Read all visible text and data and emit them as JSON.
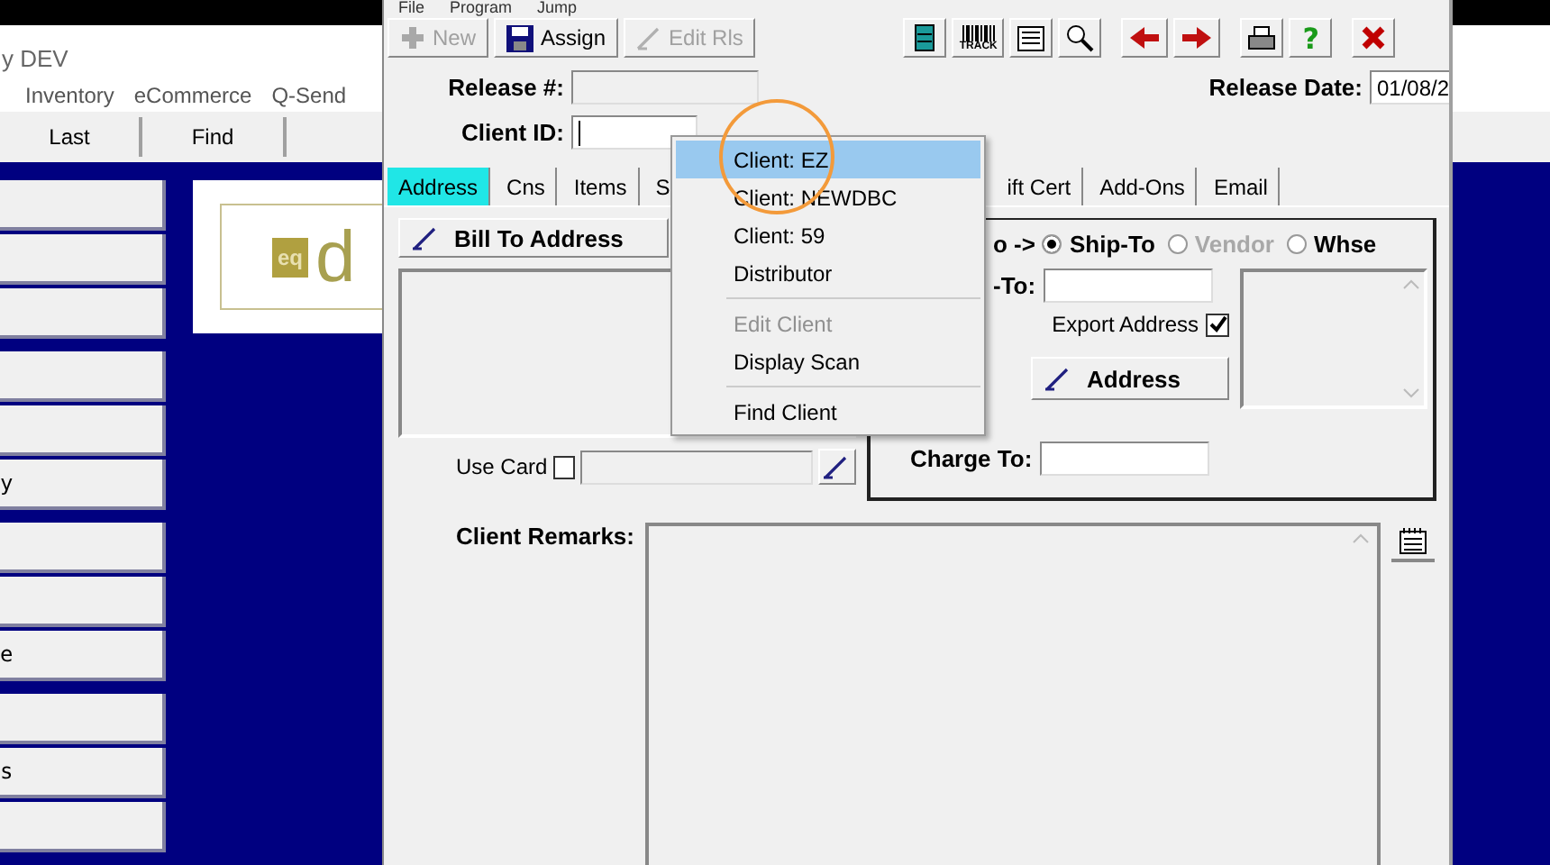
{
  "background_app": {
    "title": "y DEV",
    "menu": [
      "Inventory",
      "eCommerce",
      "Q-Send"
    ],
    "toolbar": [
      {
        "label": "Last"
      },
      {
        "label": "Find"
      }
    ],
    "side_groups": [
      [
        {
          "kind": "blank"
        },
        {
          "kind": "blank"
        },
        {
          "kind": "blank"
        }
      ],
      [
        {
          "kind": "blank"
        },
        {
          "kind": "blank"
        },
        {
          "kind": "labeled",
          "label": "y"
        }
      ],
      [
        {
          "kind": "blank"
        },
        {
          "kind": "blank"
        },
        {
          "kind": "labeled",
          "label": "e"
        }
      ],
      [
        {
          "kind": "blank"
        },
        {
          "kind": "labeled",
          "label": "s"
        },
        {
          "kind": "blank"
        }
      ]
    ],
    "logo": {
      "badge": "eq",
      "text": "d"
    }
  },
  "dialog": {
    "menu": [
      "File",
      "Program",
      "Jump"
    ],
    "toolbar": [
      {
        "label": "New",
        "disabled": true,
        "kind": "plus"
      },
      {
        "label": "Assign",
        "disabled": false,
        "kind": "floppy"
      },
      {
        "label": "Edit Rls",
        "disabled": true,
        "kind": "pen"
      }
    ],
    "tools": [
      {
        "kind": "cabinet"
      },
      {
        "kind": "barcode",
        "label": "TRACK"
      },
      {
        "kind": "document"
      },
      {
        "kind": "magnifier"
      },
      {
        "kind": "left"
      },
      {
        "kind": "right"
      },
      {
        "kind": "printer"
      },
      {
        "kind": "help",
        "label": "?"
      },
      {
        "kind": "close"
      }
    ],
    "release_label": "Release #:",
    "release_date_label": "Release Date:",
    "release_date": "01/08/2",
    "client_id_label": "Client ID:",
    "tabs": [
      {
        "label": "Address",
        "selected": true
      },
      {
        "label": "Cns",
        "selected": false
      },
      {
        "label": "Items",
        "selected": false
      },
      {
        "label": "S",
        "selected": false
      },
      {
        "label": "ift Cert",
        "selected": false
      },
      {
        "label": "Add-Ons",
        "selected": false
      },
      {
        "label": "Email",
        "selected": false
      }
    ],
    "bill_to_button": "Bill To Address",
    "use_card": {
      "label": "Use Card",
      "checked": false
    },
    "address_target_label": "o ->",
    "radios": [
      {
        "label": "Ship-To",
        "selected": true,
        "disabled": false
      },
      {
        "label": "Vendor",
        "selected": false,
        "disabled": true
      },
      {
        "label": "Whse",
        "selected": false,
        "disabled": false
      }
    ],
    "ship_to_label": "-To:",
    "export_address": {
      "label": "Export Address",
      "checked": true
    },
    "address_button": "Address",
    "charge_to_label": "Charge To:",
    "remarks_label": "Client Remarks:",
    "popup_menu": [
      {
        "kind": "item",
        "label": "Client: EZ",
        "selected": true,
        "disabled": false
      },
      {
        "kind": "item",
        "label": "Client: NEWDBC",
        "selected": false,
        "disabled": false
      },
      {
        "kind": "item",
        "label": "Client: 59",
        "selected": false,
        "disabled": false
      },
      {
        "kind": "item",
        "label": "Distributor",
        "selected": false,
        "disabled": false
      },
      {
        "kind": "separator"
      },
      {
        "kind": "item",
        "label": "Edit Client",
        "selected": false,
        "disabled": true
      },
      {
        "kind": "item",
        "label": "Display Scan",
        "selected": false,
        "disabled": false
      },
      {
        "kind": "separator"
      },
      {
        "kind": "item",
        "label": "Find Client",
        "selected": false,
        "disabled": false
      }
    ]
  }
}
